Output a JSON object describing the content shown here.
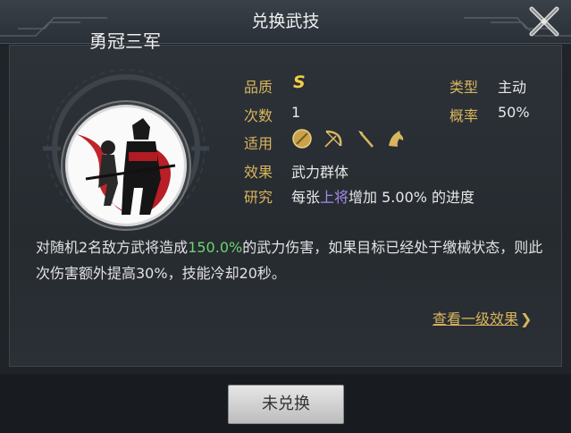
{
  "header": {
    "title": "兑换武技"
  },
  "skill": {
    "name": "勇冠三军",
    "quality_label": "品质",
    "quality_value": "S",
    "type_label": "类型",
    "type_value": "主动",
    "count_label": "次数",
    "count_value": "1",
    "rate_label": "概率",
    "rate_value": "50%",
    "applicable_label": "适用",
    "applicable_icons": [
      "shield-icon",
      "bow-icon",
      "spear-icon",
      "horse-icon"
    ],
    "effect_label": "效果",
    "effect_value": "武力群体",
    "research_label": "研究",
    "research_prefix": "每张",
    "research_highlight": "上将",
    "research_suffix": "增加 5.00% 的进度"
  },
  "description": {
    "prefix": "对随机2名敌方武将造成",
    "highlight": "150.0%",
    "suffix": "的武力伤害，如果目标已经处于缴械状态，则此次伤害额外提高30%，技能冷却20秒。"
  },
  "link": {
    "label": "查看一级效果"
  },
  "button": {
    "label": "未兑换"
  },
  "colors": {
    "label_gold": "#d9b55c",
    "quality_gold": "#f3cf45",
    "highlight_green": "#6fd36f",
    "highlight_purple": "#a58be8"
  }
}
